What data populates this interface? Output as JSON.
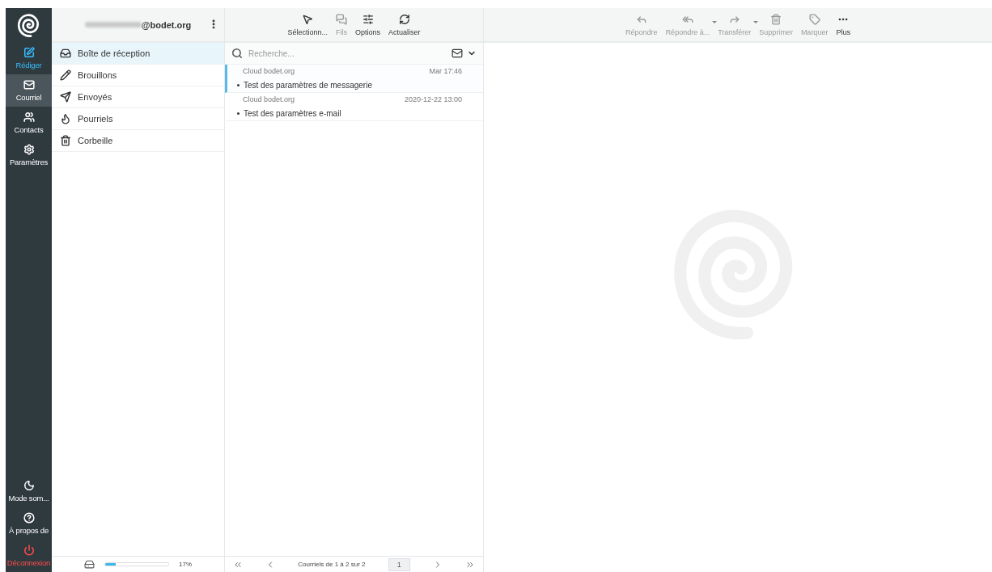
{
  "nav": {
    "top": [
      {
        "label": "Rédiger",
        "kind": "compose",
        "selected": false
      },
      {
        "label": "Courriel",
        "kind": "mail",
        "selected": true
      },
      {
        "label": "Contacts",
        "kind": "contacts",
        "selected": false
      },
      {
        "label": "Paramètres",
        "kind": "settings",
        "selected": false
      }
    ],
    "bottom": [
      {
        "label": "Mode som...",
        "kind": "night",
        "selected": false
      },
      {
        "label": "À propos de",
        "kind": "about",
        "selected": false
      },
      {
        "label": "Déconnexion",
        "kind": "logout",
        "selected": false
      }
    ]
  },
  "account": {
    "name": "@bodet.org"
  },
  "folders": [
    {
      "label": "Boîte de réception",
      "kind": "inbox",
      "selected": true
    },
    {
      "label": "Brouillons",
      "kind": "drafts",
      "selected": false
    },
    {
      "label": "Envoyés",
      "kind": "sent",
      "selected": false
    },
    {
      "label": "Pourriels",
      "kind": "junk",
      "selected": false
    },
    {
      "label": "Corbeille",
      "kind": "trash",
      "selected": false
    }
  ],
  "quota": {
    "level": 0.17,
    "reading": "17%"
  },
  "list_toolbar": [
    {
      "label": "Sélectionn...",
      "kind": "select",
      "disabled": false
    },
    {
      "label": "Fils",
      "kind": "threads",
      "disabled": true
    },
    {
      "label": "Options",
      "kind": "options",
      "disabled": false
    },
    {
      "label": "Actualiser",
      "kind": "refresh",
      "disabled": false
    }
  ],
  "search": {
    "placeholder": "Recherche..."
  },
  "messages": [
    {
      "from": "Cloud bodet.org",
      "date": "Mar 17:46",
      "subject": "Test des paramètres de messagerie",
      "selected": true
    },
    {
      "from": "Cloud bodet.org",
      "date": "2020-12-22 13:00",
      "subject": "Test des paramètres e-mail",
      "selected": false
    }
  ],
  "pager": {
    "text": "Courriels de 1 à 2 sur 2",
    "page": "1"
  },
  "message_toolbar": [
    {
      "label": "Répondre",
      "kind": "reply",
      "disabled": true,
      "dropdown": false
    },
    {
      "label": "Répondre à...",
      "kind": "reply-all",
      "disabled": true,
      "dropdown": true
    },
    {
      "label": "Transférer",
      "kind": "forward",
      "disabled": true,
      "dropdown": true
    },
    {
      "label": "Supprimer",
      "kind": "delete",
      "disabled": true,
      "dropdown": false
    },
    {
      "label": "Marquer",
      "kind": "tag",
      "disabled": true,
      "dropdown": false
    },
    {
      "label": "Plus",
      "kind": "more",
      "disabled": false,
      "dropdown": false
    }
  ]
}
